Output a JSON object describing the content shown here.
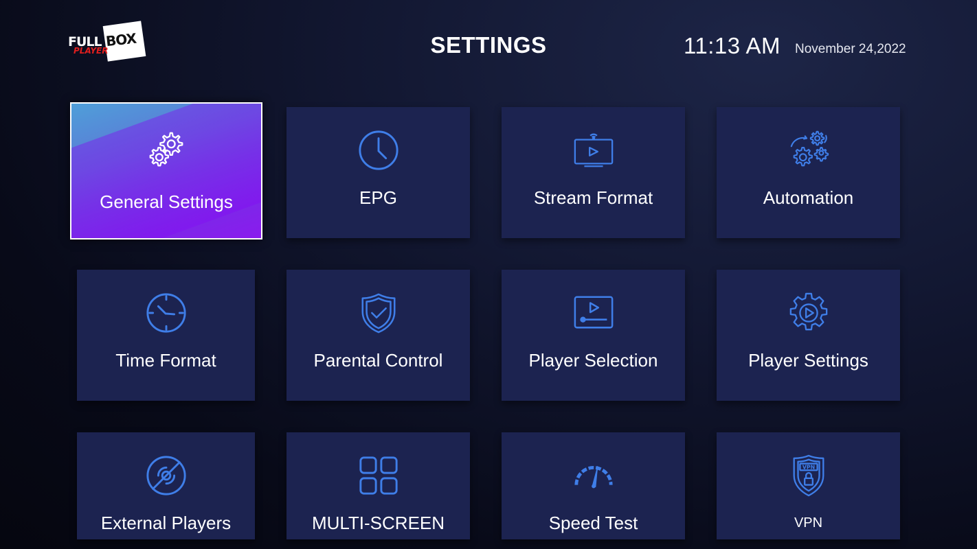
{
  "header": {
    "logo_text_full": "FULL",
    "logo_text_box": "BOX",
    "logo_text_player": "PLAYER",
    "title": "SETTINGS",
    "time": "11:13 AM",
    "date": "November 24,2022"
  },
  "colors": {
    "tile_bg": "#1c2350",
    "icon_blue": "#3f7ee8",
    "active_gradient_start": "#4f9fd9",
    "active_gradient_end": "#8a1bee"
  },
  "tiles": [
    {
      "label": "General Settings",
      "icon": "gears-icon",
      "selected": true
    },
    {
      "label": "EPG",
      "icon": "clock-icon"
    },
    {
      "label": "Stream Format",
      "icon": "tv-stream-icon"
    },
    {
      "label": "Automation",
      "icon": "automation-gears-icon"
    },
    {
      "label": "Time Format",
      "icon": "time-format-clock-icon"
    },
    {
      "label": "Parental Control",
      "icon": "shield-check-icon"
    },
    {
      "label": "Player Selection",
      "icon": "video-player-icon"
    },
    {
      "label": "Player Settings",
      "icon": "gear-play-icon"
    },
    {
      "label": "External Players",
      "icon": "disc-slash-icon"
    },
    {
      "label": "MULTI-SCREEN",
      "icon": "grid-squares-icon"
    },
    {
      "label": "Speed Test",
      "icon": "speedometer-icon"
    },
    {
      "label": "VPN",
      "icon": "vpn-shield-lock-icon"
    }
  ]
}
